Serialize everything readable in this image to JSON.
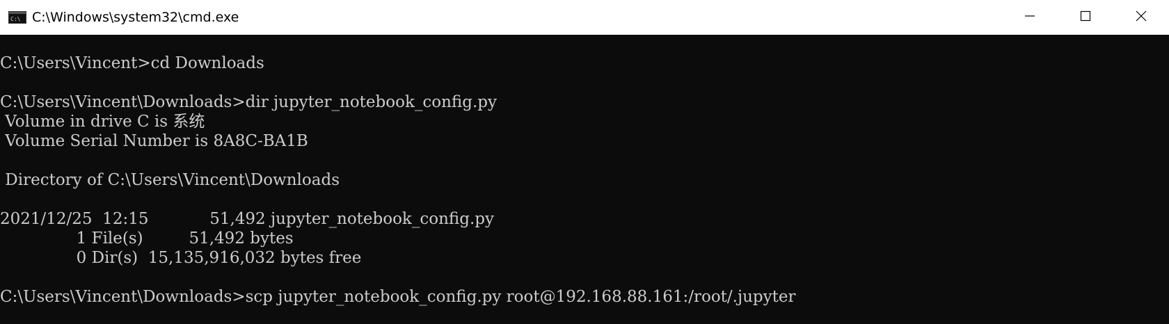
{
  "window": {
    "title": "C:\\Windows\\system32\\cmd.exe",
    "icon": "cmd-app-icon",
    "controls": {
      "minimize_icon": "minimize-icon",
      "maximize_icon": "maximize-icon",
      "close_icon": "close-icon"
    }
  },
  "console": {
    "lines": [
      "C:\\Users\\Vincent>cd Downloads",
      "",
      "C:\\Users\\Vincent\\Downloads>dir jupyter_notebook_config.py",
      " Volume in drive C is 系统",
      " Volume Serial Number is 8A8C-BA1B",
      "",
      " Directory of C:\\Users\\Vincent\\Downloads",
      "",
      "2021/12/25  12:15            51,492 jupyter_notebook_config.py",
      "               1 File(s)         51,492 bytes",
      "               0 Dir(s)  15,135,916,032 bytes free",
      "",
      "C:\\Users\\Vincent\\Downloads>scp jupyter_notebook_config.py root@192.168.88.161:/root/.jupyter"
    ]
  },
  "colors": {
    "titlebar_bg": "#ffffff",
    "console_bg": "#0c0c0c",
    "console_fg": "#cccccc"
  }
}
